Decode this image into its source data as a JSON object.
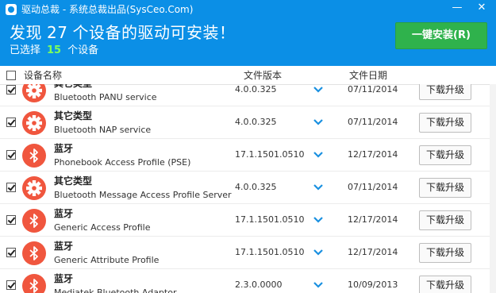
{
  "window": {
    "title": "驱动总裁 - 系统总裁出品(SysCeo.Com)",
    "minimize_symbol": "—",
    "close_symbol": "✕"
  },
  "banner": {
    "headline_prefix": "发现",
    "driver_count": "27",
    "headline_suffix": "个设备的驱动可安装！",
    "selected_prefix": "已选择",
    "selected_count": "15",
    "selected_suffix": "个设备",
    "install_button": "一键安装(R)"
  },
  "columns": {
    "device_name": "设备名称",
    "file_version": "文件版本",
    "file_date": "文件日期"
  },
  "devices": [
    {
      "type": "其它类型",
      "name": "Bluetooth PANU service",
      "version": "4.0.0.325",
      "date": "07/11/2014",
      "icon": "gear-icon",
      "checked": true,
      "button": "下载升级"
    },
    {
      "type": "其它类型",
      "name": "Bluetooth NAP service",
      "version": "4.0.0.325",
      "date": "07/11/2014",
      "icon": "gear-icon",
      "checked": true,
      "button": "下载升级"
    },
    {
      "type": "蓝牙",
      "name": "Phonebook Access Profile (PSE)",
      "version": "17.1.1501.0510",
      "date": "12/17/2014",
      "icon": "bluetooth-icon",
      "checked": true,
      "button": "下载升级"
    },
    {
      "type": "其它类型",
      "name": "Bluetooth Message Access Profile Server",
      "version": "4.0.0.325",
      "date": "07/11/2014",
      "icon": "gear-icon",
      "checked": true,
      "button": "下载升级"
    },
    {
      "type": "蓝牙",
      "name": "Generic Access Profile",
      "version": "17.1.1501.0510",
      "date": "12/17/2014",
      "icon": "bluetooth-icon",
      "checked": true,
      "button": "下载升级"
    },
    {
      "type": "蓝牙",
      "name": "Generic Attribute Profile",
      "version": "17.1.1501.0510",
      "date": "12/17/2014",
      "icon": "bluetooth-icon",
      "checked": true,
      "button": "下载升级"
    },
    {
      "type": "蓝牙",
      "name": "Mediatek Bluetooth Adaptor",
      "version": "2.3.0.0000",
      "date": "10/09/2013",
      "icon": "bluetooth-icon",
      "checked": true,
      "button": "下载升级"
    }
  ],
  "colors": {
    "header_blue": "#0b8fe6",
    "install_green": "#2fb24c",
    "icon_red": "#f0563e",
    "chevron_blue": "#1a90e0"
  }
}
